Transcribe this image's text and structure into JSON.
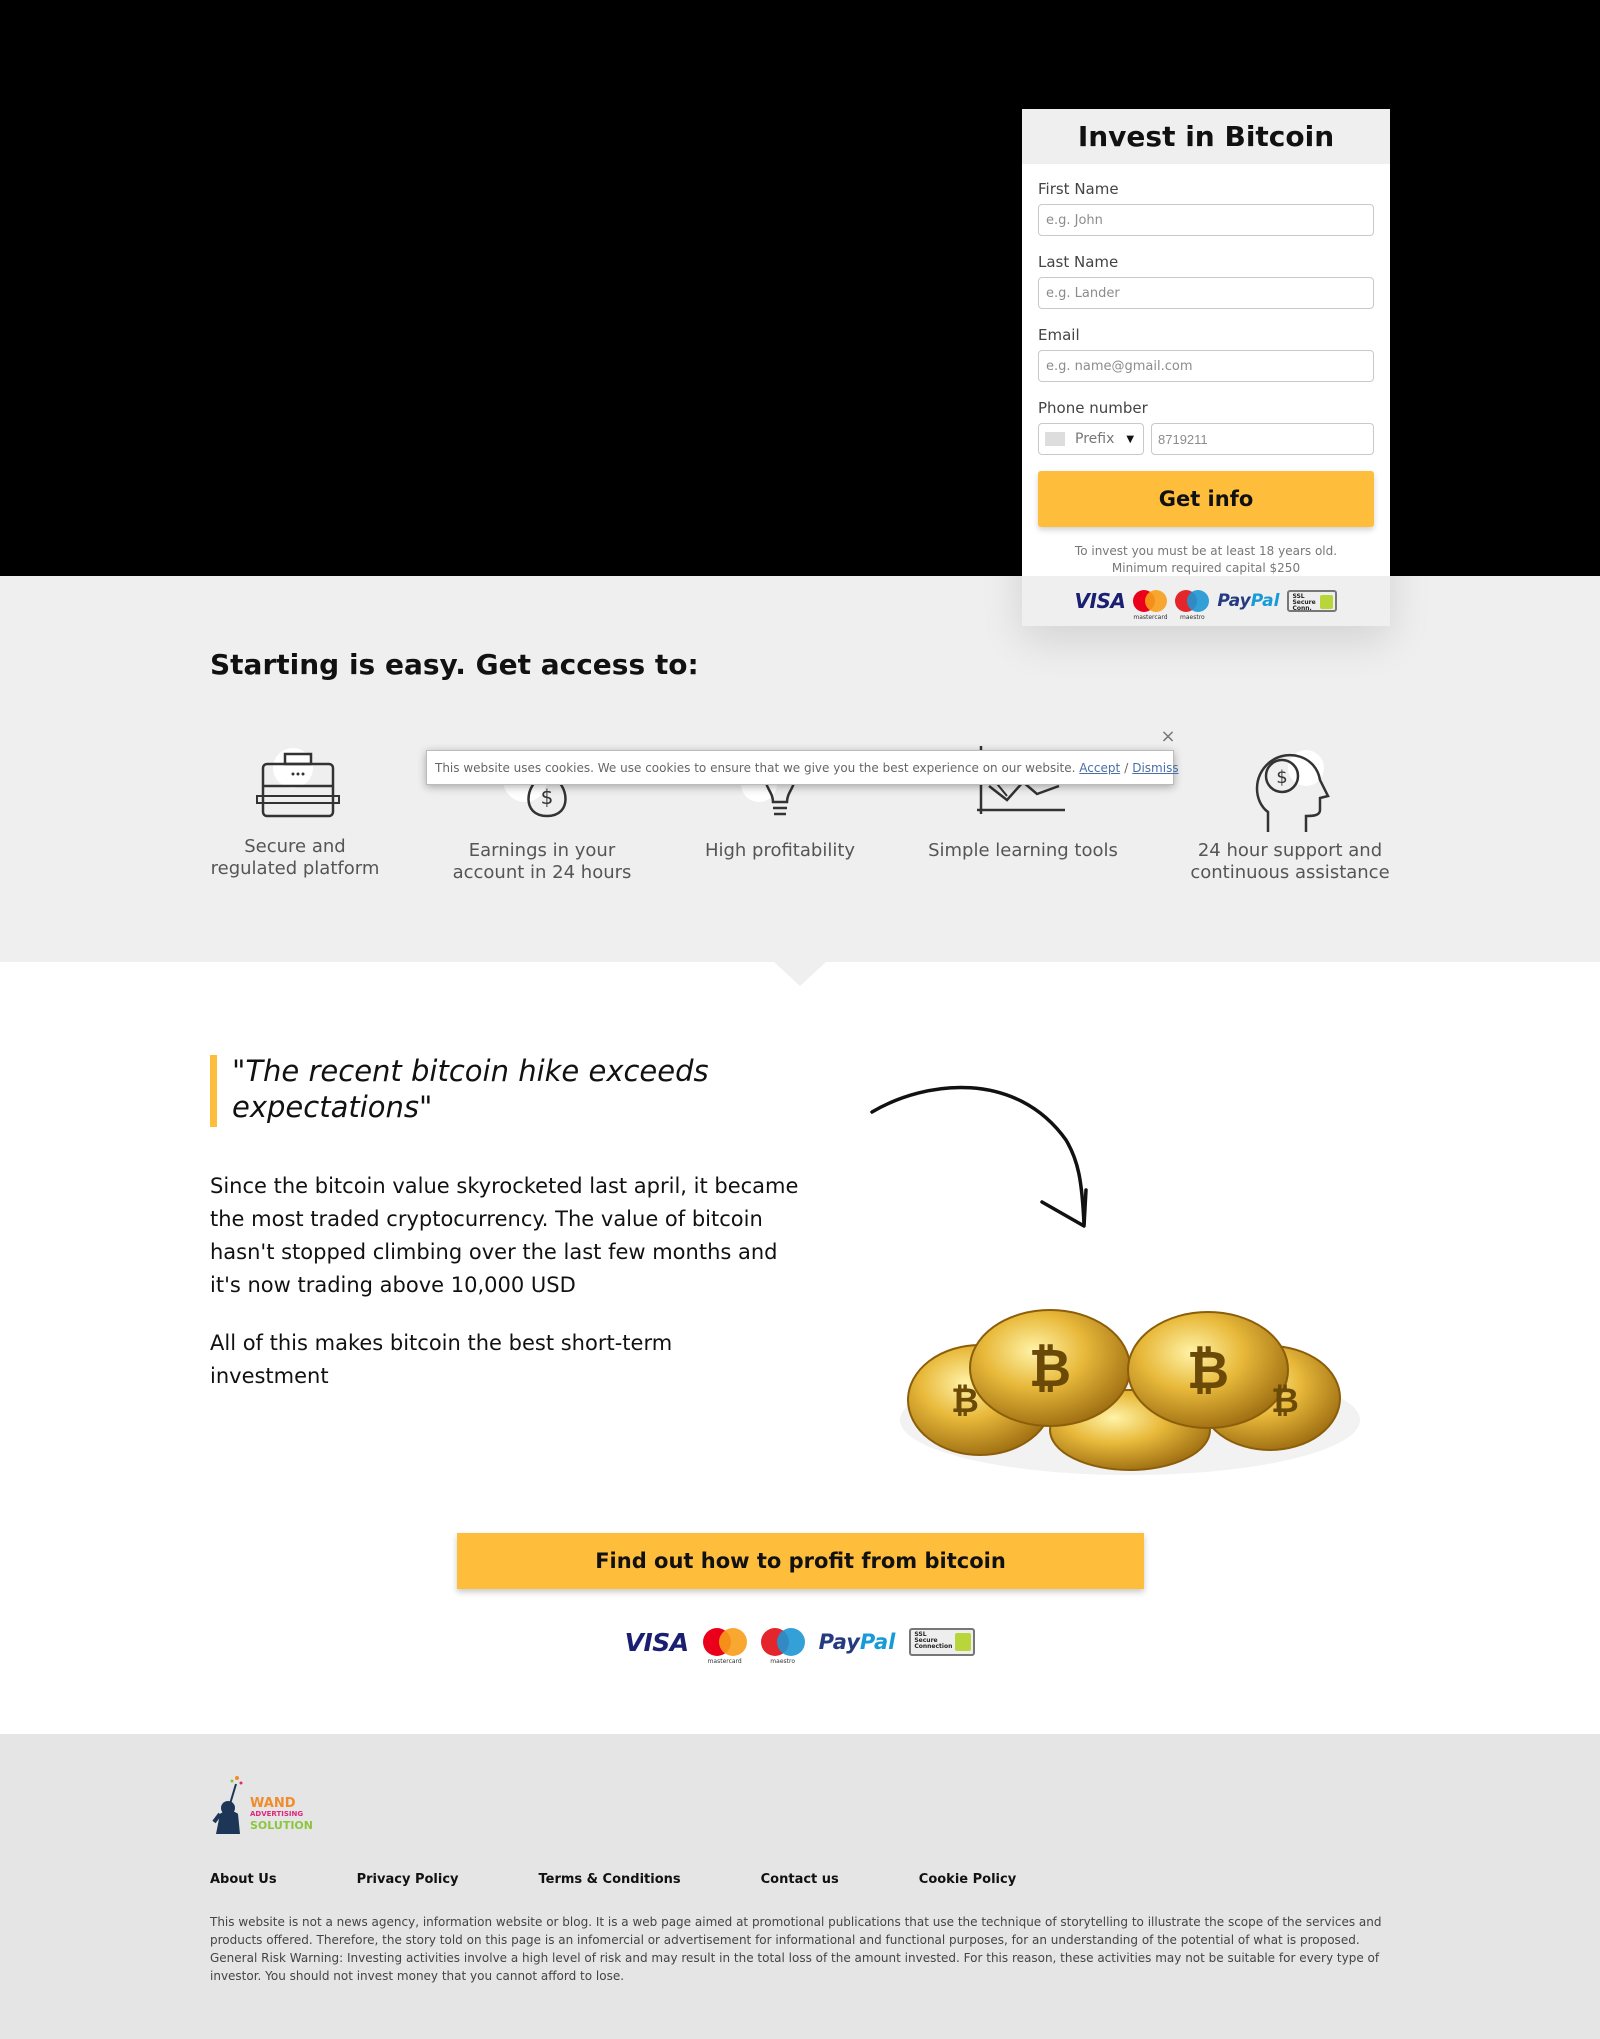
{
  "form": {
    "title": "Invest in Bitcoin",
    "first_name_label": "First Name",
    "first_name_placeholder": "e.g. John",
    "last_name_label": "Last Name",
    "last_name_placeholder": "e.g. Lander",
    "email_label": "Email",
    "email_placeholder": "e.g. name@gmail.com",
    "phone_label": "Phone number",
    "prefix_label": "Prefix",
    "phone_placeholder": "8719211",
    "submit_label": "Get info",
    "disclaimer_line1": "To invest you must be at least 18 years old.",
    "disclaimer_line2": "Minimum required capital $250"
  },
  "payments": {
    "visa": "VISA",
    "mastercard": "mastercard",
    "maestro": "maestro",
    "paypal_a": "Pay",
    "paypal_b": "Pal",
    "ssl": "SSL Secure Connection"
  },
  "features": {
    "title": "Starting is easy. Get access to:",
    "items": [
      {
        "line1": "Secure and",
        "line2": "regulated platform",
        "icon": "briefcase-icon"
      },
      {
        "line1": "Earnings in your",
        "line2": "account in 24 hours",
        "icon": "money-bag-icon"
      },
      {
        "line1": "High profitability",
        "line2": "",
        "icon": "lightbulb-icon"
      },
      {
        "line1": "Simple learning tools",
        "line2": "",
        "icon": "chart-icon"
      },
      {
        "line1": "24 hour support and",
        "line2": "continuous assistance",
        "icon": "head-dollar-icon"
      }
    ]
  },
  "cookie": {
    "text": "This website uses cookies. We use cookies to ensure that we give you the best experience on our website.",
    "accept": "Accept",
    "separator": "/",
    "dismiss": "Dismiss",
    "close": "×"
  },
  "article": {
    "quote_line1": "\"The recent bitcoin hike exceeds",
    "quote_line2": "expectations\"",
    "para1_l1": "Since the bitcoin value skyrocketed last april, it became",
    "para1_l2": "the most traded cryptocurrency. The value of bitcoin",
    "para1_l3": "hasn't stopped climbing over the last few months and",
    "para1_l4": "it's now trading above 10,000 USD",
    "para2_l1": "All of this makes bitcoin the best short-term",
    "para2_l2": "investment",
    "cta_label": "Find out how to profit from bitcoin"
  },
  "footer": {
    "logo_line1": "WAND",
    "logo_line2": "ADVERTISING",
    "logo_line3": "SOLUTION",
    "links": [
      "About Us",
      "Privacy Policy",
      "Terms & Conditions",
      "Contact us",
      "Cookie Policy"
    ],
    "text_l1": "This website is not a news agency, information website or blog. It is a web page aimed at promotional publications that use the technique of storytelling to illustrate the scope of the services and",
    "text_l2": "products offered. Therefore, the story told on this page is an infomercial or advertisement for informational and functional purposes, for an understanding of the potential of what is proposed.",
    "text_l3": "General Risk Warning: Investing activities involve a high level of risk and may result in the total loss of the amount invested. For this reason, these activities may not be suitable for every type of",
    "text_l4": "investor. You should not invest money that you cannot afford to lose."
  },
  "colors": {
    "accent": "#ffbd3c",
    "hero_bg": "#000000",
    "section_bg": "#efefef",
    "footer_bg": "#e5e5e5"
  }
}
